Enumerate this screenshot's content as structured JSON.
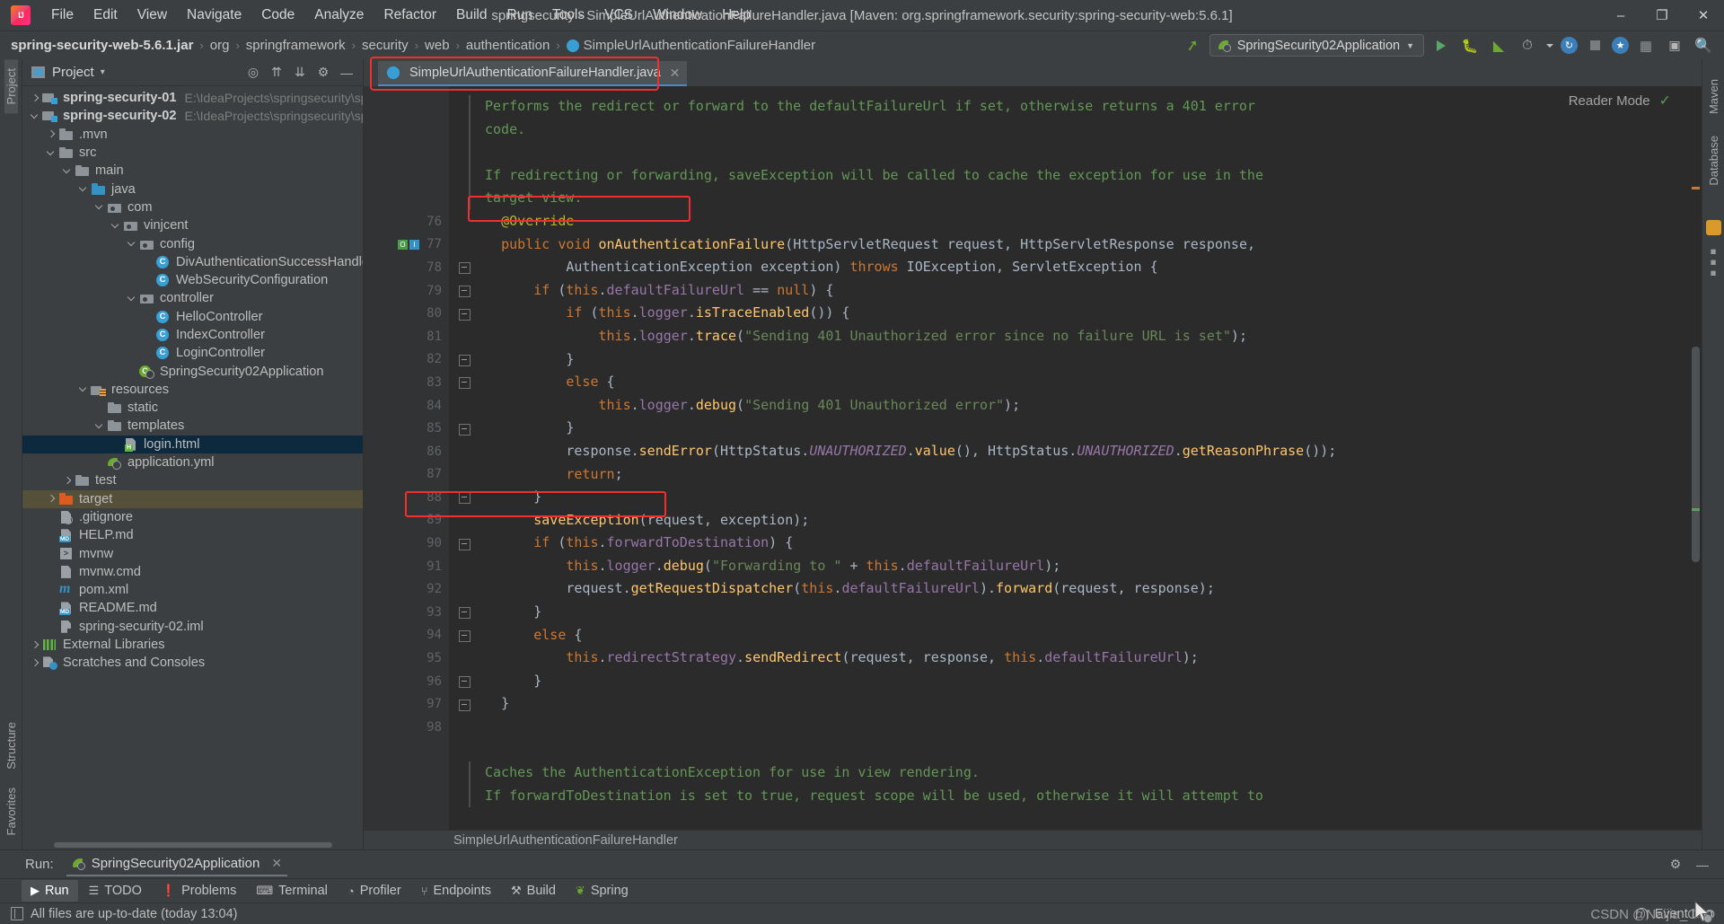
{
  "titlebar": {
    "app_icon": "intellij-logo",
    "menus": [
      "File",
      "Edit",
      "View",
      "Navigate",
      "Code",
      "Analyze",
      "Refactor",
      "Build",
      "Run",
      "Tools",
      "VCS",
      "Window",
      "Help"
    ],
    "window_title": "springsecurity - SimpleUrlAuthenticationFailureHandler.java [Maven: org.springframework.security:spring-security-web:5.6.1]",
    "minimize": "–",
    "restore": "❐",
    "close": "✕"
  },
  "navbar": {
    "breadcrumbs": [
      "spring-security-web-5.6.1.jar",
      "org",
      "springframework",
      "security",
      "web",
      "authentication",
      "SimpleUrlAuthenticationFailureHandler"
    ],
    "separator": "›",
    "run_config": "SpringSecurity02Application",
    "dropdown_caret": "▼"
  },
  "left_rail": {
    "project": "Project",
    "structure": "Structure",
    "favorites": "Favorites"
  },
  "right_rail": {
    "maven": "Maven",
    "database": "Database"
  },
  "project_panel": {
    "title": "Project",
    "caret": "▾",
    "tree": [
      {
        "depth": 0,
        "arrow": "r",
        "icon": "folder-mod",
        "label": "spring-security-01",
        "bold": true,
        "path": "E:\\IdeaProjects\\springsecurity\\spring"
      },
      {
        "depth": 0,
        "arrow": "d",
        "icon": "folder-mod",
        "label": "spring-security-02",
        "bold": true,
        "path": "E:\\IdeaProjects\\springsecurity\\spring"
      },
      {
        "depth": 1,
        "arrow": "r",
        "icon": "folder",
        "label": ".mvn",
        "bold": false,
        "path": ""
      },
      {
        "depth": 1,
        "arrow": "d",
        "icon": "folder",
        "label": "src",
        "bold": false,
        "path": ""
      },
      {
        "depth": 2,
        "arrow": "d",
        "icon": "folder",
        "label": "main",
        "bold": false,
        "path": ""
      },
      {
        "depth": 3,
        "arrow": "d",
        "icon": "folder-blue",
        "label": "java",
        "bold": false,
        "path": ""
      },
      {
        "depth": 4,
        "arrow": "d",
        "icon": "folder-pkg",
        "label": "com",
        "bold": false,
        "path": ""
      },
      {
        "depth": 5,
        "arrow": "d",
        "icon": "folder-pkg",
        "label": "vinjcent",
        "bold": false,
        "path": ""
      },
      {
        "depth": 6,
        "arrow": "d",
        "icon": "folder-pkg",
        "label": "config",
        "bold": false,
        "path": ""
      },
      {
        "depth": 7,
        "arrow": "",
        "icon": "cls",
        "label": "DivAuthenticationSuccessHandler",
        "bold": false,
        "path": ""
      },
      {
        "depth": 7,
        "arrow": "",
        "icon": "cls",
        "label": "WebSecurityConfiguration",
        "bold": false,
        "path": ""
      },
      {
        "depth": 6,
        "arrow": "d",
        "icon": "folder-pkg",
        "label": "controller",
        "bold": false,
        "path": ""
      },
      {
        "depth": 7,
        "arrow": "",
        "icon": "cls",
        "label": "HelloController",
        "bold": false,
        "path": ""
      },
      {
        "depth": 7,
        "arrow": "",
        "icon": "cls",
        "label": "IndexController",
        "bold": false,
        "path": ""
      },
      {
        "depth": 7,
        "arrow": "",
        "icon": "cls",
        "label": "LoginController",
        "bold": false,
        "path": ""
      },
      {
        "depth": 6,
        "arrow": "",
        "icon": "springcls",
        "label": "SpringSecurity02Application",
        "bold": false,
        "path": ""
      },
      {
        "depth": 3,
        "arrow": "d",
        "icon": "folder-res",
        "label": "resources",
        "bold": false,
        "path": ""
      },
      {
        "depth": 4,
        "arrow": "",
        "icon": "folder",
        "label": "static",
        "bold": false,
        "path": ""
      },
      {
        "depth": 4,
        "arrow": "d",
        "icon": "folder",
        "label": "templates",
        "bold": false,
        "path": ""
      },
      {
        "depth": 5,
        "arrow": "",
        "icon": "doc doc-h",
        "label": "login.html",
        "bold": false,
        "path": "",
        "state": "sel"
      },
      {
        "depth": 4,
        "arrow": "",
        "icon": "yml",
        "label": "application.yml",
        "bold": false,
        "path": ""
      },
      {
        "depth": 2,
        "arrow": "r",
        "icon": "folder",
        "label": "test",
        "bold": false,
        "path": ""
      },
      {
        "depth": 1,
        "arrow": "r",
        "icon": "folder-orange",
        "label": "target",
        "bold": false,
        "path": "",
        "state": "sel-target"
      },
      {
        "depth": 1,
        "arrow": "",
        "icon": "doc doc-git",
        "label": ".gitignore",
        "bold": false,
        "path": ""
      },
      {
        "depth": 1,
        "arrow": "",
        "icon": "doc doc-md",
        "label": "HELP.md",
        "bold": false,
        "path": ""
      },
      {
        "depth": 1,
        "arrow": "",
        "icon": "mvnw",
        "label": "mvnw",
        "bold": false,
        "path": ""
      },
      {
        "depth": 1,
        "arrow": "",
        "icon": "doc",
        "label": "mvnw.cmd",
        "bold": false,
        "path": ""
      },
      {
        "depth": 1,
        "arrow": "",
        "icon": "mvn",
        "label": "pom.xml",
        "bold": false,
        "path": ""
      },
      {
        "depth": 1,
        "arrow": "",
        "icon": "doc doc-md",
        "label": "README.md",
        "bold": false,
        "path": ""
      },
      {
        "depth": 1,
        "arrow": "",
        "icon": "doc doc-sq",
        "label": "spring-security-02.iml",
        "bold": false,
        "path": ""
      },
      {
        "depth": 0,
        "arrow": "r",
        "icon": "lib",
        "label": "External Libraries",
        "bold": false,
        "path": ""
      },
      {
        "depth": 0,
        "arrow": "r",
        "icon": "scratch",
        "label": "Scratches and Consoles",
        "bold": false,
        "path": ""
      }
    ]
  },
  "editor": {
    "tab_label": "SimpleUrlAuthenticationFailureHandler.java",
    "tab_close": "✕",
    "reader_mode": "Reader Mode",
    "reader_check": "✓",
    "breadcrumb_footer": "SimpleUrlAuthenticationFailureHandler",
    "doc_top": [
      "Performs the redirect or forward to the defaultFailureUrl if set, otherwise returns a 401 error",
      "code.",
      "",
      "If redirecting or forwarding, saveException will be called to cache the exception for use in the",
      "target view."
    ],
    "doc_bottom": [
      "Caches the AuthenticationException for use in view rendering.",
      "If forwardToDestination is set to true, request scope will be used, otherwise it will attempt to"
    ],
    "first_line_number": 76,
    "last_line_number": 98,
    "lines": [
      {
        "n": 76,
        "text": "    @Override"
      },
      {
        "n": 77,
        "text": "    public void onAuthenticationFailure(HttpServletRequest request, HttpServletResponse response,"
      },
      {
        "n": 78,
        "text": "            AuthenticationException exception) throws IOException, ServletException {"
      },
      {
        "n": 79,
        "text": "        if (this.defaultFailureUrl == null) {"
      },
      {
        "n": 80,
        "text": "            if (this.logger.isTraceEnabled()) {"
      },
      {
        "n": 81,
        "text": "                this.logger.trace(\"Sending 401 Unauthorized error since no failure URL is set\");"
      },
      {
        "n": 82,
        "text": "            }"
      },
      {
        "n": 83,
        "text": "            else {"
      },
      {
        "n": 84,
        "text": "                this.logger.debug(\"Sending 401 Unauthorized error\");"
      },
      {
        "n": 85,
        "text": "            }"
      },
      {
        "n": 86,
        "text": "            response.sendError(HttpStatus.UNAUTHORIZED.value(), HttpStatus.UNAUTHORIZED.getReasonPhrase());"
      },
      {
        "n": 87,
        "text": "            return;"
      },
      {
        "n": 88,
        "text": "        }"
      },
      {
        "n": 89,
        "text": "        saveException(request, exception);"
      },
      {
        "n": 90,
        "text": "        if (this.forwardToDestination) {"
      },
      {
        "n": 91,
        "text": "            this.logger.debug(\"Forwarding to \" + this.defaultFailureUrl);"
      },
      {
        "n": 92,
        "text": "            request.getRequestDispatcher(this.defaultFailureUrl).forward(request, response);"
      },
      {
        "n": 93,
        "text": "        }"
      },
      {
        "n": 94,
        "text": "        else {"
      },
      {
        "n": 95,
        "text": "            this.redirectStrategy.sendRedirect(request, response, this.defaultFailureUrl);"
      },
      {
        "n": 96,
        "text": "        }"
      },
      {
        "n": 97,
        "text": "    }"
      },
      {
        "n": 98,
        "text": ""
      }
    ],
    "highlights": [
      {
        "name": "onAuthenticationFailure"
      },
      {
        "name": "saveException(request, exception);"
      }
    ]
  },
  "run_window": {
    "label": "Run:",
    "tab": "SpringSecurity02Application",
    "close": "✕",
    "settings_icon": "gear-icon",
    "minimize_icon": "minimize-icon"
  },
  "bottom_toolbar": [
    {
      "label": "Run",
      "icon": "play-icon",
      "active": true
    },
    {
      "label": "TODO",
      "icon": "list-icon",
      "active": false
    },
    {
      "label": "Problems",
      "icon": "warning-icon",
      "active": false
    },
    {
      "label": "Terminal",
      "icon": "terminal-icon",
      "active": false
    },
    {
      "label": "Profiler",
      "icon": "profiler-icon",
      "active": false
    },
    {
      "label": "Endpoints",
      "icon": "endpoints-icon",
      "active": false
    },
    {
      "label": "Build",
      "icon": "hammer-icon",
      "active": false
    },
    {
      "label": "Spring",
      "icon": "leaf-icon",
      "active": false
    }
  ],
  "statusbar": {
    "message": "All files are up-to-date (today 13:04)",
    "event_log": "Event Log",
    "watermark": "CSDN @Naijia_OvO"
  },
  "colors": {
    "accent_blue": "#4a88c7",
    "highlight_red": "#f03030",
    "selection_blue": "#0d293e",
    "selection_target": "#55503a",
    "editor_bg": "#2b2b2b",
    "panel_bg": "#3c3f41",
    "gutter_bg": "#313335",
    "keyword": "#cc7832",
    "string": "#6a8759",
    "field": "#9876aa",
    "method": "#ffc66d",
    "annotation": "#bbb529",
    "doc_comment": "#629755"
  }
}
